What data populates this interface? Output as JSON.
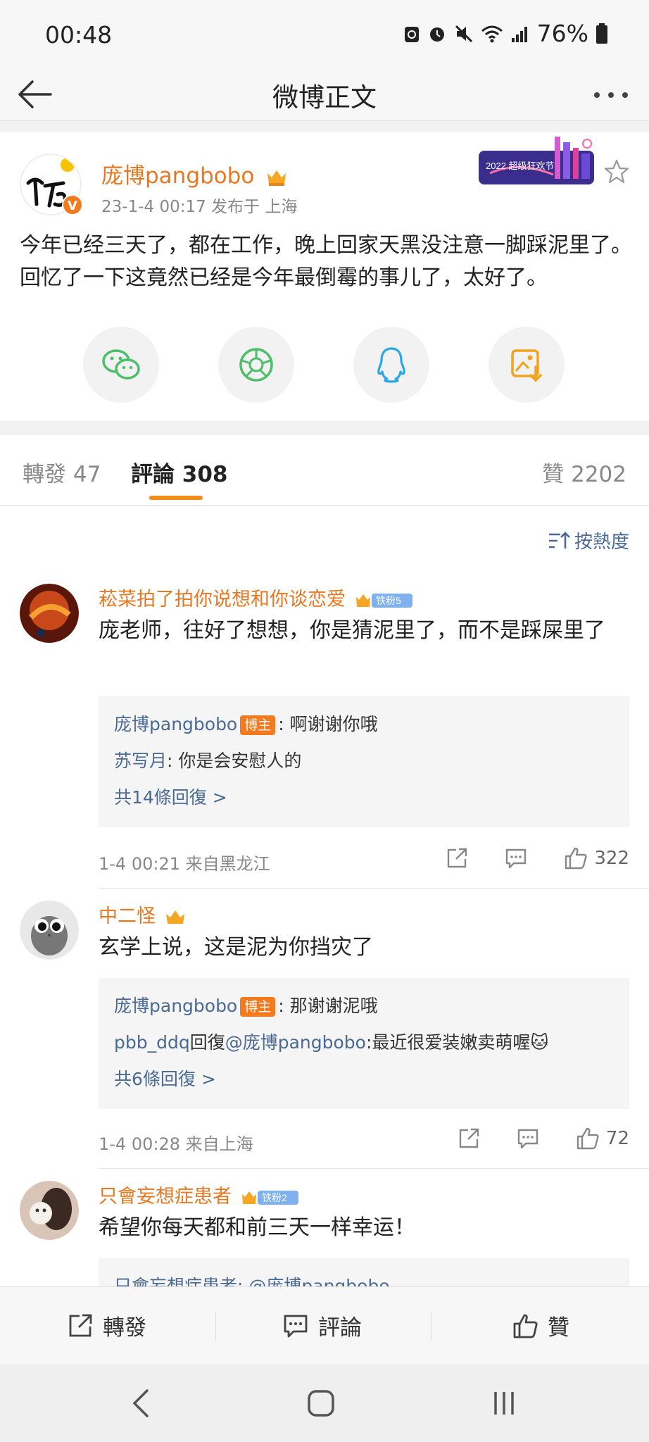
{
  "status": {
    "time": "00:48",
    "battery": "76%"
  },
  "nav": {
    "title": "微博正文"
  },
  "post": {
    "author": "庞博pangbobo",
    "meta": "23-1-4 00:17   发布于 上海",
    "banner_text": "2022 超级狂欢节",
    "text": "今年已经三天了，都在工作，晚上回家天黑没注意一脚踩泥里了。回忆了一下这竟然已经是今年最倒霉的事儿了，太好了。"
  },
  "tabs": {
    "repost": "轉發 47",
    "comment": "評論 308",
    "like": "贊 2202"
  },
  "sort": {
    "label": "按熱度"
  },
  "comments": [
    {
      "name": "菘菜拍了拍你说想和你谈恋爱",
      "fan_badge": "铁粉5",
      "text": "庞老师，往好了想想，你是猜泥里了，而不是踩屎里了",
      "replies": [
        {
          "name": "庞博pangbobo",
          "tag": "博主",
          "text": ": 啊谢谢你哦"
        },
        {
          "name": "苏写月",
          "text": ": 你是会安慰人的"
        }
      ],
      "more": "共14條回復 >",
      "meta": "1-4 00:21  来自黑龙江",
      "likes": "322"
    },
    {
      "name": "中二怪",
      "text": "玄学上说，这是泥为你挡灾了",
      "replies": [
        {
          "name": "庞博pangbobo",
          "tag": "博主",
          "text": ": 那谢谢泥哦"
        },
        {
          "name": "pbb_ddq",
          "mid": "回復",
          "name2": "@庞博pangbobo",
          "text": ":最近很爱装嫩卖萌喔🐱"
        }
      ],
      "more": "共6條回復 >",
      "meta": "1-4 00:28  来自上海",
      "likes": "72"
    },
    {
      "name": "只會妄想症患者",
      "fan_badge": "铁粉2",
      "text": "希望你每天都和前三天一样幸运！",
      "replies": [
        {
          "name": "只會妄想症患者",
          "text": ": @庞博pangbobo"
        }
      ]
    }
  ],
  "action_bar": {
    "repost": "轉發",
    "comment": "評論",
    "like": "贊"
  },
  "colors": {
    "accent": "#e87722",
    "link": "#4a6a94",
    "tab_underline": "#f28c1c"
  }
}
